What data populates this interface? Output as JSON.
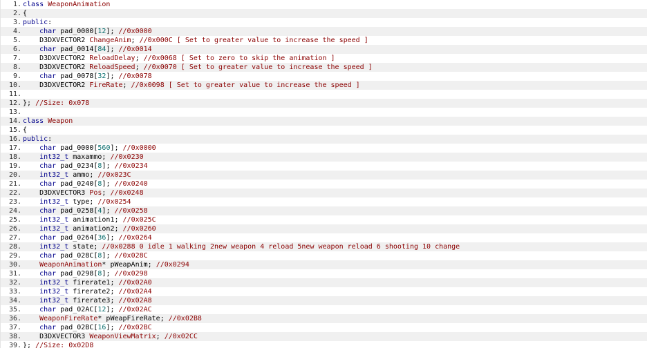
{
  "lines": [
    {
      "n": "1.",
      "tokens": [
        [
          "kw",
          "class "
        ],
        [
          "id",
          "WeaponAnimation"
        ]
      ]
    },
    {
      "n": "2.",
      "tokens": [
        [
          "pn",
          "{"
        ]
      ]
    },
    {
      "n": "3.",
      "tokens": [
        [
          "kw",
          "public"
        ],
        [
          "pn",
          ":"
        ]
      ]
    },
    {
      "n": "4.",
      "tokens": [
        [
          "plain",
          "    "
        ],
        [
          "ty",
          "char"
        ],
        [
          "plain",
          " pad_0000["
        ],
        [
          "num",
          "12"
        ],
        [
          "plain",
          "]; "
        ],
        [
          "cmt",
          "//0x0000"
        ]
      ]
    },
    {
      "n": "5.",
      "tokens": [
        [
          "plain",
          "    D3DXVECTOR2 "
        ],
        [
          "id",
          "ChangeAnim"
        ],
        [
          "plain",
          "; "
        ],
        [
          "cmt",
          "//0x000C [ Set to greater value to increase the speed ]"
        ]
      ]
    },
    {
      "n": "6.",
      "tokens": [
        [
          "plain",
          "    "
        ],
        [
          "ty",
          "char"
        ],
        [
          "plain",
          " pad_0014["
        ],
        [
          "num",
          "84"
        ],
        [
          "plain",
          "]; "
        ],
        [
          "cmt",
          "//0x0014"
        ]
      ]
    },
    {
      "n": "7.",
      "tokens": [
        [
          "plain",
          "    D3DXVECTOR2 "
        ],
        [
          "id",
          "ReloadDelay"
        ],
        [
          "plain",
          "; "
        ],
        [
          "cmt",
          "//0x0068 [ Set to zero to skip the animation ]"
        ]
      ]
    },
    {
      "n": "8.",
      "tokens": [
        [
          "plain",
          "    D3DXVECTOR2 "
        ],
        [
          "id",
          "ReloadSpeed"
        ],
        [
          "plain",
          "; "
        ],
        [
          "cmt",
          "//0x0070 [ Set to greater value to increase the speed ]"
        ]
      ]
    },
    {
      "n": "9.",
      "tokens": [
        [
          "plain",
          "    "
        ],
        [
          "ty",
          "char"
        ],
        [
          "plain",
          " pad_0078["
        ],
        [
          "num",
          "32"
        ],
        [
          "plain",
          "]; "
        ],
        [
          "cmt",
          "//0x0078"
        ]
      ]
    },
    {
      "n": "10.",
      "tokens": [
        [
          "plain",
          "    D3DXVECTOR2 "
        ],
        [
          "id",
          "FireRate"
        ],
        [
          "plain",
          "; "
        ],
        [
          "cmt",
          "//0x0098 [ Set to greater value to increase the speed ]"
        ]
      ]
    },
    {
      "n": "11.",
      "tokens": []
    },
    {
      "n": "12.",
      "tokens": [
        [
          "pn",
          "}; "
        ],
        [
          "cmt",
          "//Size: 0x078"
        ]
      ]
    },
    {
      "n": "13.",
      "tokens": []
    },
    {
      "n": "14.",
      "tokens": [
        [
          "kw",
          "class "
        ],
        [
          "id",
          "Weapon"
        ]
      ]
    },
    {
      "n": "15.",
      "tokens": [
        [
          "pn",
          "{"
        ]
      ]
    },
    {
      "n": "16.",
      "tokens": [
        [
          "kw",
          "public"
        ],
        [
          "pn",
          ":"
        ]
      ]
    },
    {
      "n": "17.",
      "tokens": [
        [
          "plain",
          "    "
        ],
        [
          "ty",
          "char"
        ],
        [
          "plain",
          " pad_0000["
        ],
        [
          "num",
          "560"
        ],
        [
          "plain",
          "]; "
        ],
        [
          "cmt",
          "//0x0000"
        ]
      ]
    },
    {
      "n": "18.",
      "tokens": [
        [
          "plain",
          "    "
        ],
        [
          "ty",
          "int32_t"
        ],
        [
          "plain",
          " maxammo; "
        ],
        [
          "cmt",
          "//0x0230"
        ]
      ]
    },
    {
      "n": "19.",
      "tokens": [
        [
          "plain",
          "    "
        ],
        [
          "ty",
          "char"
        ],
        [
          "plain",
          " pad_0234["
        ],
        [
          "num",
          "8"
        ],
        [
          "plain",
          "]; "
        ],
        [
          "cmt",
          "//0x0234"
        ]
      ]
    },
    {
      "n": "20.",
      "tokens": [
        [
          "plain",
          "    "
        ],
        [
          "ty",
          "int32_t"
        ],
        [
          "plain",
          " ammo; "
        ],
        [
          "cmt",
          "//0x023C"
        ]
      ]
    },
    {
      "n": "21.",
      "tokens": [
        [
          "plain",
          "    "
        ],
        [
          "ty",
          "char"
        ],
        [
          "plain",
          " pad_0240["
        ],
        [
          "num",
          "8"
        ],
        [
          "plain",
          "]; "
        ],
        [
          "cmt",
          "//0x0240"
        ]
      ]
    },
    {
      "n": "22.",
      "tokens": [
        [
          "plain",
          "    D3DXVECTOR3 "
        ],
        [
          "id",
          "Pos"
        ],
        [
          "plain",
          "; "
        ],
        [
          "cmt",
          "//0x0248"
        ]
      ]
    },
    {
      "n": "23.",
      "tokens": [
        [
          "plain",
          "    "
        ],
        [
          "ty",
          "int32_t"
        ],
        [
          "plain",
          " type; "
        ],
        [
          "cmt",
          "//0x0254"
        ]
      ]
    },
    {
      "n": "24.",
      "tokens": [
        [
          "plain",
          "    "
        ],
        [
          "ty",
          "char"
        ],
        [
          "plain",
          " pad_0258["
        ],
        [
          "num",
          "4"
        ],
        [
          "plain",
          "]; "
        ],
        [
          "cmt",
          "//0x0258"
        ]
      ]
    },
    {
      "n": "25.",
      "tokens": [
        [
          "plain",
          "    "
        ],
        [
          "ty",
          "int32_t"
        ],
        [
          "plain",
          " animation1; "
        ],
        [
          "cmt",
          "//0x025C"
        ]
      ]
    },
    {
      "n": "26.",
      "tokens": [
        [
          "plain",
          "    "
        ],
        [
          "ty",
          "int32_t"
        ],
        [
          "plain",
          " animation2; "
        ],
        [
          "cmt",
          "//0x0260"
        ]
      ]
    },
    {
      "n": "27.",
      "tokens": [
        [
          "plain",
          "    "
        ],
        [
          "ty",
          "char"
        ],
        [
          "plain",
          " pad_0264["
        ],
        [
          "num",
          "36"
        ],
        [
          "plain",
          "]; "
        ],
        [
          "cmt",
          "//0x0264"
        ]
      ]
    },
    {
      "n": "28.",
      "tokens": [
        [
          "plain",
          "    "
        ],
        [
          "ty",
          "int32_t"
        ],
        [
          "plain",
          " state; "
        ],
        [
          "cmt",
          "//0x0288 0 idle 1 walking 2new weapon 4 reload 5new weapon reload 6 shooting 10 change"
        ]
      ]
    },
    {
      "n": "29.",
      "tokens": [
        [
          "plain",
          "    "
        ],
        [
          "ty",
          "char"
        ],
        [
          "plain",
          " pad_028C["
        ],
        [
          "num",
          "8"
        ],
        [
          "plain",
          "]; "
        ],
        [
          "cmt",
          "//0x028C"
        ]
      ]
    },
    {
      "n": "30.",
      "tokens": [
        [
          "plain",
          "    "
        ],
        [
          "id",
          "WeaponAnimation"
        ],
        [
          "plain",
          "* pWeapAnim; "
        ],
        [
          "cmt",
          "//0x0294"
        ]
      ]
    },
    {
      "n": "31.",
      "tokens": [
        [
          "plain",
          "    "
        ],
        [
          "ty",
          "char"
        ],
        [
          "plain",
          " pad_0298["
        ],
        [
          "num",
          "8"
        ],
        [
          "plain",
          "]; "
        ],
        [
          "cmt",
          "//0x0298"
        ]
      ]
    },
    {
      "n": "32.",
      "tokens": [
        [
          "plain",
          "    "
        ],
        [
          "ty",
          "int32_t"
        ],
        [
          "plain",
          " firerate1; "
        ],
        [
          "cmt",
          "//0x02A0"
        ]
      ]
    },
    {
      "n": "33.",
      "tokens": [
        [
          "plain",
          "    "
        ],
        [
          "ty",
          "int32_t"
        ],
        [
          "plain",
          " firerate2; "
        ],
        [
          "cmt",
          "//0x02A4"
        ]
      ]
    },
    {
      "n": "34.",
      "tokens": [
        [
          "plain",
          "    "
        ],
        [
          "ty",
          "int32_t"
        ],
        [
          "plain",
          " firerate3; "
        ],
        [
          "cmt",
          "//0x02A8"
        ]
      ]
    },
    {
      "n": "35.",
      "tokens": [
        [
          "plain",
          "    "
        ],
        [
          "ty",
          "char"
        ],
        [
          "plain",
          " pad_02AC["
        ],
        [
          "num",
          "12"
        ],
        [
          "plain",
          "]; "
        ],
        [
          "cmt",
          "//0x02AC"
        ]
      ]
    },
    {
      "n": "36.",
      "tokens": [
        [
          "plain",
          "    "
        ],
        [
          "id",
          "WeaponFireRate"
        ],
        [
          "plain",
          "* pWeapFireRate; "
        ],
        [
          "cmt",
          "//0x02B8"
        ]
      ]
    },
    {
      "n": "37.",
      "tokens": [
        [
          "plain",
          "    "
        ],
        [
          "ty",
          "char"
        ],
        [
          "plain",
          " pad_02BC["
        ],
        [
          "num",
          "16"
        ],
        [
          "plain",
          "]; "
        ],
        [
          "cmt",
          "//0x02BC"
        ]
      ]
    },
    {
      "n": "38.",
      "tokens": [
        [
          "plain",
          "    D3DXVECTOR3 "
        ],
        [
          "id",
          "WeaponViewMatrix"
        ],
        [
          "plain",
          "; "
        ],
        [
          "cmt",
          "//0x02CC"
        ]
      ]
    },
    {
      "n": "39.",
      "tokens": [
        [
          "pn",
          "}; "
        ],
        [
          "cmt",
          "//Size: 0x02D8"
        ]
      ]
    }
  ],
  "colors": {
    "keyword": "#00008b",
    "type": "#00008b",
    "number": "#0a6e6e",
    "comment": "#8b0000",
    "identifier": "#8b0000",
    "alt_row": "#f0f0f0"
  }
}
